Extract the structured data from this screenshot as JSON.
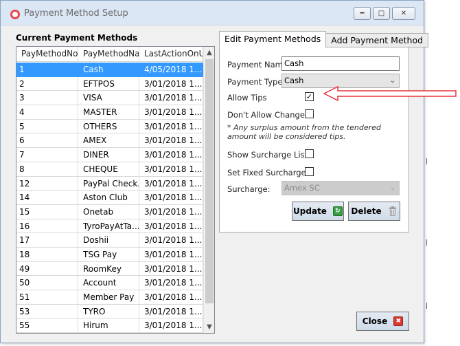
{
  "window": {
    "title": "Payment Method Setup",
    "minimize_icon": "minimize-icon",
    "maximize_icon": "maximize-icon",
    "close_icon": "close-icon"
  },
  "payment_methods": {
    "title": "Current Payment Methods",
    "columns": [
      "PayMethodNo",
      "PayMethodNam",
      "LastActionOnU"
    ],
    "selected_index": 0,
    "rows": [
      [
        "1",
        "Cash",
        "4/05/2018 1..."
      ],
      [
        "2",
        "EFTPOS",
        "3/01/2018 1..."
      ],
      [
        "3",
        "VISA",
        "3/01/2018 1..."
      ],
      [
        "4",
        "MASTER",
        "3/01/2018 1..."
      ],
      [
        "5",
        "OTHERS",
        "3/01/2018 1..."
      ],
      [
        "6",
        "AMEX",
        "3/01/2018 1..."
      ],
      [
        "7",
        "DINER",
        "3/01/2018 1..."
      ],
      [
        "8",
        "CHEQUE",
        "3/01/2018 1..."
      ],
      [
        "12",
        "PayPal Check...",
        "3/01/2018 1..."
      ],
      [
        "14",
        "Aston Club",
        "3/01/2018 1..."
      ],
      [
        "15",
        "Onetab",
        "3/01/2018 1..."
      ],
      [
        "16",
        "TyroPayAtTa...",
        "3/01/2018 1..."
      ],
      [
        "17",
        "Doshii",
        "3/01/2018 1..."
      ],
      [
        "18",
        "TSG Pay",
        "3/01/2018 1..."
      ],
      [
        "49",
        "RoomKey",
        "3/01/2018 1..."
      ],
      [
        "50",
        "Account",
        "3/01/2018 1..."
      ],
      [
        "51",
        "Member Pay",
        "3/01/2018 1..."
      ],
      [
        "53",
        "TYRO",
        "3/01/2018 1..."
      ],
      [
        "55",
        "Hirum",
        "3/01/2018 1..."
      ]
    ]
  },
  "tabs": {
    "edit": "Edit Payment Methods",
    "add": "Add Payment Method",
    "active": "edit"
  },
  "form": {
    "payment_name_label": "Payment Name:",
    "payment_name_value": "Cash",
    "payment_type_label": "Payment Type:",
    "payment_type_value": "Cash",
    "allow_tips_label": "Allow Tips",
    "allow_tips_checked": true,
    "dont_allow_change_label": "Don't Allow Change",
    "dont_allow_change_checked": false,
    "note": "* Any surplus amount from the tendered amount will be considered tips.",
    "show_surcharge_label": "Show Surcharge List:",
    "show_surcharge_checked": false,
    "fixed_surcharge_label": "Set Fixed Surcharge:",
    "fixed_surcharge_checked": false,
    "surcharge_label": "Surcharge:",
    "surcharge_value": "Amex SC"
  },
  "buttons": {
    "update": "Update",
    "delete": "Delete",
    "close": "Close"
  },
  "annotation": {
    "arrow_color": "#e8343a"
  },
  "colors": {
    "selection": "#3399ff",
    "title_icon": "#e8484e"
  }
}
